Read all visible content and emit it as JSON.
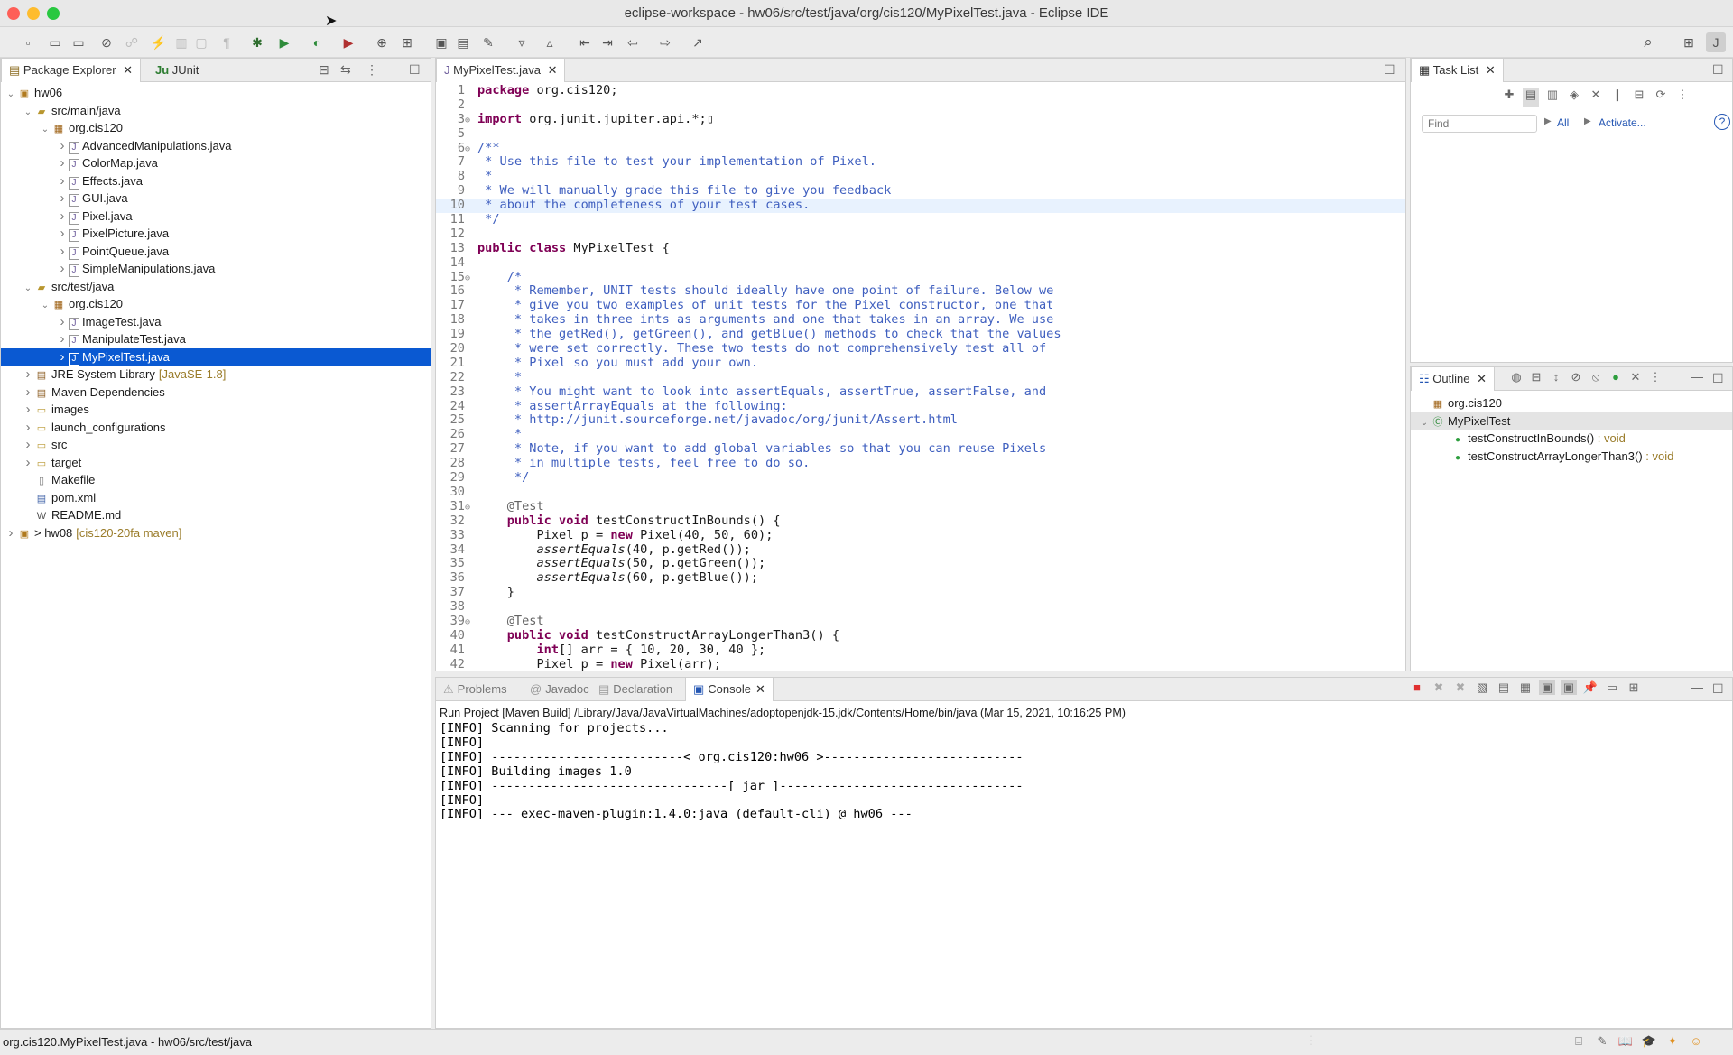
{
  "window": {
    "title": "eclipse-workspace - hw06/src/test/java/org/cis120/MyPixelTest.java - Eclipse IDE"
  },
  "colors": {
    "selection": "#0a59d2",
    "keyword": "#7f0055",
    "comment": "#3f5fbf",
    "close": "#fe5f57",
    "minimize": "#febc2e",
    "zoom": "#28c840"
  },
  "left_tabs": [
    {
      "label": "Package Explorer",
      "icon": "package-explorer-icon"
    },
    {
      "label": "JUnit",
      "icon": "junit-icon"
    }
  ],
  "tree": [
    {
      "label": "hw06",
      "depth": 0,
      "chevron": "down",
      "icon": "project-icon"
    },
    {
      "label": "src/main/java",
      "depth": 1,
      "chevron": "down",
      "icon": "source-folder-icon"
    },
    {
      "label": "org.cis120",
      "depth": 2,
      "chevron": "down",
      "icon": "package-icon"
    },
    {
      "label": "AdvancedManipulations.java",
      "depth": 3,
      "chevron": "right",
      "icon": "java-file-icon"
    },
    {
      "label": "ColorMap.java",
      "depth": 3,
      "chevron": "right",
      "icon": "java-file-icon"
    },
    {
      "label": "Effects.java",
      "depth": 3,
      "chevron": "right",
      "icon": "java-file-icon"
    },
    {
      "label": "GUI.java",
      "depth": 3,
      "chevron": "right",
      "icon": "java-file-icon"
    },
    {
      "label": "Pixel.java",
      "depth": 3,
      "chevron": "right",
      "icon": "java-file-icon"
    },
    {
      "label": "PixelPicture.java",
      "depth": 3,
      "chevron": "right",
      "icon": "java-file-icon"
    },
    {
      "label": "PointQueue.java",
      "depth": 3,
      "chevron": "right",
      "icon": "java-file-icon"
    },
    {
      "label": "SimpleManipulations.java",
      "depth": 3,
      "chevron": "right",
      "icon": "java-file-icon"
    },
    {
      "label": "src/test/java",
      "depth": 1,
      "chevron": "down",
      "icon": "source-folder-icon"
    },
    {
      "label": "org.cis120",
      "depth": 2,
      "chevron": "down",
      "icon": "package-icon"
    },
    {
      "label": "ImageTest.java",
      "depth": 3,
      "chevron": "right",
      "icon": "java-file-icon"
    },
    {
      "label": "ManipulateTest.java",
      "depth": 3,
      "chevron": "right",
      "icon": "java-file-icon"
    },
    {
      "label": "MyPixelTest.java",
      "depth": 3,
      "chevron": "right",
      "icon": "java-file-icon",
      "selected": true
    },
    {
      "label": "JRE System Library",
      "suffix": "[JavaSE-1.8]",
      "depth": 1,
      "chevron": "right",
      "icon": "library-icon"
    },
    {
      "label": "Maven Dependencies",
      "depth": 1,
      "chevron": "right",
      "icon": "library-icon"
    },
    {
      "label": "images",
      "depth": 1,
      "chevron": "right",
      "icon": "folder-icon"
    },
    {
      "label": "launch_configurations",
      "depth": 1,
      "chevron": "right",
      "icon": "folder-icon"
    },
    {
      "label": "src",
      "depth": 1,
      "chevron": "right",
      "icon": "folder-icon"
    },
    {
      "label": "target",
      "depth": 1,
      "chevron": "right",
      "icon": "folder-icon"
    },
    {
      "label": "Makefile",
      "depth": 1,
      "chevron": "none",
      "icon": "file-icon"
    },
    {
      "label": "pom.xml",
      "depth": 1,
      "chevron": "none",
      "icon": "xml-file-icon"
    },
    {
      "label": "README.md",
      "depth": 1,
      "chevron": "none",
      "icon": "markdown-file-icon"
    },
    {
      "label": "> hw08",
      "suffix": "[cis120-20fa maven]",
      "depth": 0,
      "chevron": "right",
      "icon": "project-icon"
    }
  ],
  "editor": {
    "tab": "MyPixelTest.java",
    "lines": [
      {
        "n": "1",
        "html": "<span class='kw'>package</span> org.cis120;"
      },
      {
        "n": "2",
        "html": ""
      },
      {
        "n": "3",
        "html": "<span class='kw'>import</span> org.junit.jupiter.api.*;▯",
        "fold": "plus"
      },
      {
        "n": "5",
        "html": ""
      },
      {
        "n": "6",
        "html": "<span class='cm'>/**</span>",
        "fold": "minus"
      },
      {
        "n": "7",
        "html": "<span class='cm'> * Use this file to test your implementation of Pixel.</span>"
      },
      {
        "n": "8",
        "html": "<span class='cm'> *</span>"
      },
      {
        "n": "9",
        "html": "<span class='cm'> * We will manually grade this file to give you feedback</span>"
      },
      {
        "n": "10",
        "html": "<span class='cm'> * about the completeness of your test cases.</span>",
        "highlight": true
      },
      {
        "n": "11",
        "html": "<span class='cm'> */</span>"
      },
      {
        "n": "12",
        "html": ""
      },
      {
        "n": "13",
        "html": "<span class='kw'>public class</span> MyPixelTest {"
      },
      {
        "n": "14",
        "html": ""
      },
      {
        "n": "15",
        "html": "    <span class='cm'>/*</span>",
        "fold": "minus"
      },
      {
        "n": "16",
        "html": "<span class='cm'>     * Remember, UNIT tests should ideally have one point of failure. Below we</span>"
      },
      {
        "n": "17",
        "html": "<span class='cm'>     * give you two examples of unit tests for the Pixel constructor, one that</span>"
      },
      {
        "n": "18",
        "html": "<span class='cm'>     * takes in three ints as arguments and one that takes in an array. We use</span>"
      },
      {
        "n": "19",
        "html": "<span class='cm'>     * the getRed(), getGreen(), and getBlue() methods to check that the values</span>"
      },
      {
        "n": "20",
        "html": "<span class='cm'>     * were set correctly. These two tests do not comprehensively test all of</span>"
      },
      {
        "n": "21",
        "html": "<span class='cm'>     * Pixel so you must add your own.</span>"
      },
      {
        "n": "22",
        "html": "<span class='cm'>     *</span>"
      },
      {
        "n": "23",
        "html": "<span class='cm'>     * You might want to look into assertEquals, assertTrue, assertFalse, and</span>"
      },
      {
        "n": "24",
        "html": "<span class='cm'>     * assertArrayEquals at the following:</span>"
      },
      {
        "n": "25",
        "html": "<span class='cm'>     * http://junit.sourceforge.net/javadoc/org/junit/Assert.html</span>"
      },
      {
        "n": "26",
        "html": "<span class='cm'>     *</span>"
      },
      {
        "n": "27",
        "html": "<span class='cm'>     * Note, if you want to add global variables so that you can reuse Pixels</span>"
      },
      {
        "n": "28",
        "html": "<span class='cm'>     * in multiple tests, feel free to do so.</span>"
      },
      {
        "n": "29",
        "html": "<span class='cm'>     */</span>"
      },
      {
        "n": "30",
        "html": ""
      },
      {
        "n": "31",
        "html": "    <span class='ann'>@Test</span>",
        "fold": "minus"
      },
      {
        "n": "32",
        "html": "    <span class='kw'>public void</span> testConstructInBounds() {"
      },
      {
        "n": "33",
        "html": "        Pixel p = <span class='kw'>new</span> Pixel(40, 50, 60);"
      },
      {
        "n": "34",
        "html": "        <span class='it'>assertEquals</span>(40, p.getRed());"
      },
      {
        "n": "35",
        "html": "        <span class='it'>assertEquals</span>(50, p.getGreen());"
      },
      {
        "n": "36",
        "html": "        <span class='it'>assertEquals</span>(60, p.getBlue());"
      },
      {
        "n": "37",
        "html": "    }"
      },
      {
        "n": "38",
        "html": ""
      },
      {
        "n": "39",
        "html": "    <span class='ann'>@Test</span>",
        "fold": "minus"
      },
      {
        "n": "40",
        "html": "    <span class='kw'>public void</span> testConstructArrayLongerThan3() {"
      },
      {
        "n": "41",
        "html": "        <span class='kw'>int</span>[] arr = { 10, 20, 30, 40 };"
      },
      {
        "n": "42",
        "html": "        Pixel p = <span class='kw'>new</span> Pixel(arr);"
      }
    ]
  },
  "task_list": {
    "tab": "Task List",
    "find_placeholder": "Find",
    "all_label": "All",
    "activate_label": "Activate...",
    "help_icon": "help-icon"
  },
  "outline": {
    "tab": "Outline",
    "items": [
      {
        "label": "org.cis120",
        "type": "",
        "depth": 0,
        "icon": "package-icon"
      },
      {
        "label": "MyPixelTest",
        "type": "",
        "depth": 0,
        "icon": "class-icon",
        "selected": true
      },
      {
        "label": "testConstructInBounds()",
        "type": " : void",
        "depth": 1,
        "icon": "public-method-icon"
      },
      {
        "label": "testConstructArrayLongerThan3()",
        "type": " : void",
        "depth": 1,
        "icon": "public-method-icon"
      }
    ]
  },
  "bottom": {
    "tabs": [
      {
        "label": "Problems",
        "icon": "problems-icon"
      },
      {
        "label": "Javadoc",
        "icon": "javadoc-icon"
      },
      {
        "label": "Declaration",
        "icon": "declaration-icon"
      },
      {
        "label": "Console",
        "icon": "console-icon",
        "active": true
      }
    ],
    "run_header": "Run Project [Maven Build] /Library/Java/JavaVirtualMachines/adoptopenjdk-15.jdk/Contents/Home/bin/java  (Mar 15, 2021, 10:16:25 PM)",
    "console_lines": [
      "[INFO] Scanning for projects...",
      "[INFO]",
      "[INFO] --------------------------< org.cis120:hw06 >---------------------------",
      "[INFO] Building images 1.0",
      "[INFO] --------------------------------[ jar ]---------------------------------",
      "[INFO]",
      "[INFO] --- exec-maven-plugin:1.4.0:java (default-cli) @ hw06 ---"
    ]
  },
  "status": {
    "text": "org.cis120.MyPixelTest.java - hw06/src/test/java"
  }
}
